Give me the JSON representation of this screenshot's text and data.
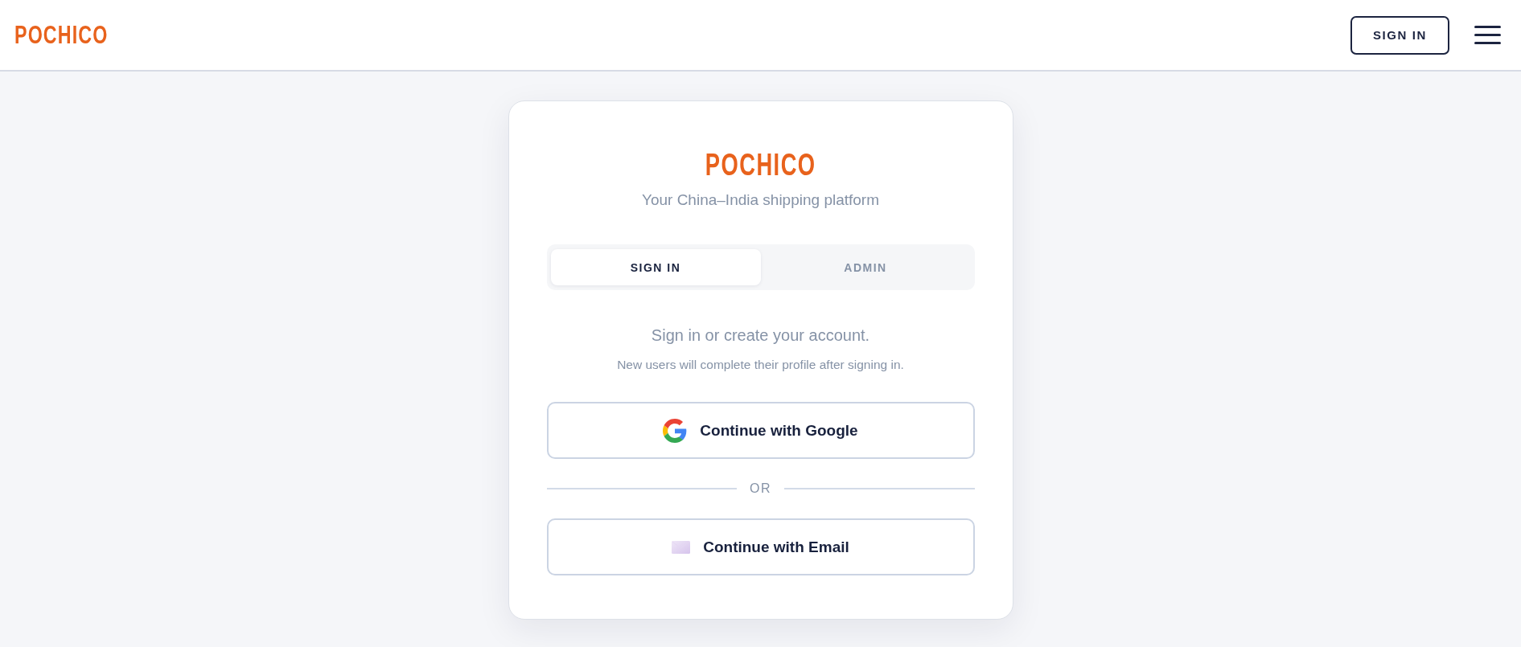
{
  "header": {
    "logo": "POCHICO",
    "sign_in_button": "SIGN IN"
  },
  "card": {
    "logo": "POCHICO",
    "tagline": "Your China–India shipping platform",
    "tabs": [
      {
        "label": "SIGN IN",
        "selected": true
      },
      {
        "label": "ADMIN",
        "selected": false
      }
    ],
    "prompt": "Sign in or create your account.",
    "note": "New users will complete their profile after signing in.",
    "options": [
      {
        "kind": "google",
        "label": "Continue with Google"
      },
      {
        "kind": "divider",
        "label": "OR"
      },
      {
        "kind": "email",
        "label": "Continue with Email"
      }
    ]
  }
}
